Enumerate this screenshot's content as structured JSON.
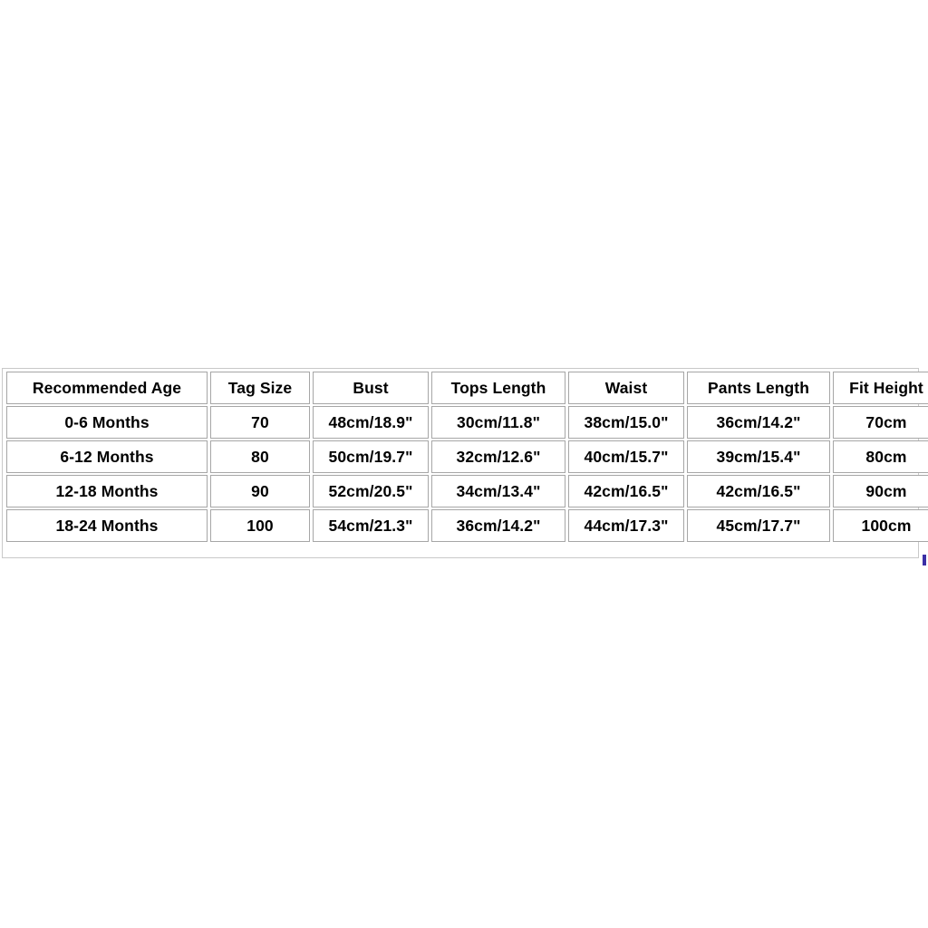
{
  "page": {
    "background_color": "#ffffff",
    "text_color": "#000000",
    "border_color": "#a6a6a6",
    "frame_color": "#c9c9c9",
    "artifact_color": "#3b2fa6"
  },
  "table": {
    "name": "baby-clothing-size-chart",
    "headers": [
      "Recommended Age",
      "Tag Size",
      "Bust",
      "Tops Length",
      "Waist",
      "Pants Length",
      "Fit Height"
    ],
    "rows": [
      {
        "recommended_age": "0-6 Months",
        "tag_size": "70",
        "bust": "48cm/18.9\"",
        "tops_length": "30cm/11.8\"",
        "waist": "38cm/15.0\"",
        "pants_length": "36cm/14.2\"",
        "fit_height": "70cm"
      },
      {
        "recommended_age": "6-12 Months",
        "tag_size": "80",
        "bust": "50cm/19.7\"",
        "tops_length": "32cm/12.6\"",
        "waist": "40cm/15.7\"",
        "pants_length": "39cm/15.4\"",
        "fit_height": "80cm"
      },
      {
        "recommended_age": "12-18 Months",
        "tag_size": "90",
        "bust": "52cm/20.5\"",
        "tops_length": "34cm/13.4\"",
        "waist": "42cm/16.5\"",
        "pants_length": "42cm/16.5\"",
        "fit_height": "90cm"
      },
      {
        "recommended_age": "18-24 Months",
        "tag_size": "100",
        "bust": "54cm/21.3\"",
        "tops_length": "36cm/14.2\"",
        "waist": "44cm/17.3\"",
        "pants_length": "45cm/17.7\"",
        "fit_height": "100cm"
      }
    ]
  }
}
